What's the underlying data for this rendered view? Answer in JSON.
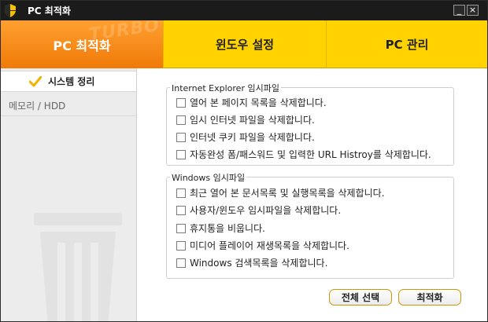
{
  "window": {
    "title": "PC 최적화",
    "minimize_label": "_",
    "close_label": "×"
  },
  "tabs": [
    {
      "label": "PC 최적화",
      "active": true
    },
    {
      "label": "윈도우 설정",
      "active": false
    },
    {
      "label": "PC 관리",
      "active": false
    }
  ],
  "watermark": {
    "text": "TURBO"
  },
  "sidebar": {
    "items": [
      {
        "label": "시스템 정리",
        "selected": true
      },
      {
        "label": "메모리 / HDD",
        "selected": false
      }
    ]
  },
  "ie_group": {
    "title": "Internet Explorer 임시파일",
    "options": [
      "열어 본 페이지 목록을 삭제합니다.",
      "임시 인터넷 파일을 삭제합니다.",
      "인터넷 쿠키 파일을 삭제합니다.",
      "자동완성 폼/패스워드 및 입력한 URL Histroy를 삭제합니다."
    ]
  },
  "windows_group": {
    "title": "Windows 임시파일",
    "options": [
      "최근 열어 본 문서목록 및 실행목록을 삭제합니다.",
      "사용자/윈도우 임시파일을 삭제합니다.",
      "휴지통을 비웁니다.",
      "미디어 플레이어 재생목록을 삭제합니다.",
      "Windows 검색목록을 삭제합니다."
    ]
  },
  "buttons": {
    "select_all": "전체 선택",
    "optimize": "최적화"
  },
  "colors": {
    "accent": "#ffd200",
    "active_tab": "#f58a12",
    "titlebar": "#1b1b1b",
    "check": "#f0b400"
  },
  "icons": {
    "app": "shield-icon",
    "sidebar_selected": "check-icon",
    "background": "trash-icon"
  }
}
